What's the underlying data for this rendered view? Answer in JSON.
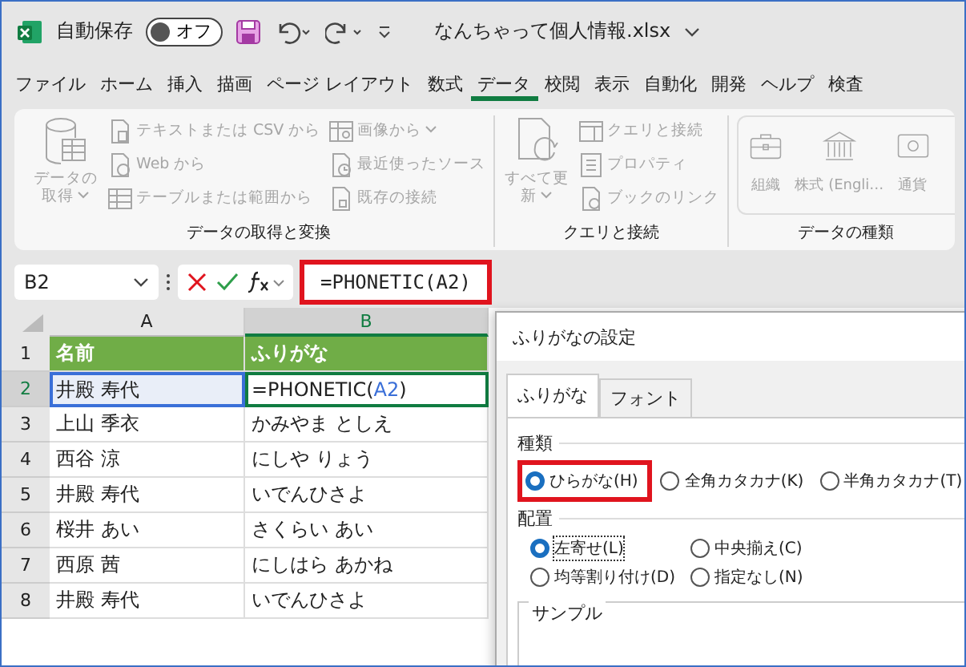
{
  "title_bar": {
    "autosave_label": "自動保存",
    "autosave_toggle": {
      "label": "オフ",
      "on": false
    },
    "file_name": "なんちゃって個人情報.xlsx"
  },
  "menu_tabs": [
    {
      "label": "ファイル",
      "selected": false
    },
    {
      "label": "ホーム",
      "selected": false
    },
    {
      "label": "挿入",
      "selected": false
    },
    {
      "label": "描画",
      "selected": false
    },
    {
      "label": "ページ レイアウト",
      "selected": false
    },
    {
      "label": "数式",
      "selected": false
    },
    {
      "label": "データ",
      "selected": true
    },
    {
      "label": "校閲",
      "selected": false
    },
    {
      "label": "表示",
      "selected": false
    },
    {
      "label": "自動化",
      "selected": false
    },
    {
      "label": "開発",
      "selected": false
    },
    {
      "label": "ヘルプ",
      "selected": false
    },
    {
      "label": "検査",
      "selected": false
    }
  ],
  "ribbon_groups": [
    {
      "label": "データの取得と変換",
      "columns": [
        [
          {
            "label": "データの取得",
            "kind": "large",
            "dropdown": true,
            "disabled": true
          }
        ],
        [
          {
            "label": "テキストまたは CSV から",
            "kind": "small",
            "dropdown": false,
            "disabled": true
          },
          {
            "label": "Web から",
            "kind": "small",
            "dropdown": false,
            "disabled": true
          },
          {
            "label": "テーブルまたは範囲から",
            "kind": "small",
            "dropdown": false,
            "disabled": true
          }
        ],
        [
          {
            "label": "画像から",
            "kind": "small",
            "dropdown": true,
            "disabled": true
          },
          {
            "label": "最近使ったソース",
            "kind": "small",
            "dropdown": false,
            "disabled": true
          },
          {
            "label": "既存の接続",
            "kind": "small",
            "dropdown": false,
            "disabled": true
          }
        ]
      ]
    },
    {
      "label": "クエリと接続",
      "columns": [
        [
          {
            "label": "すべて更新",
            "kind": "large",
            "dropdown": true,
            "disabled": true
          }
        ],
        [
          {
            "label": "クエリと接続",
            "kind": "small",
            "dropdown": false,
            "disabled": true
          },
          {
            "label": "プロパティ",
            "kind": "small",
            "dropdown": false,
            "disabled": true
          },
          {
            "label": "ブックのリンク",
            "kind": "small",
            "dropdown": false,
            "disabled": true
          }
        ]
      ]
    },
    {
      "label": "データの種類",
      "columns": [
        [
          {
            "label": "組織",
            "kind": "type",
            "dropdown": false,
            "disabled": true
          }
        ],
        [
          {
            "label": "株式 (Engli…",
            "kind": "type",
            "dropdown": false,
            "disabled": true
          }
        ],
        [
          {
            "label": "通貨",
            "kind": "type",
            "dropdown": false,
            "disabled": true
          }
        ]
      ]
    }
  ],
  "formula_bar": {
    "name_box": "B2",
    "formula": "=PHONETIC(A2)",
    "highlighted": true
  },
  "sheet": {
    "columns": [
      {
        "label": "A",
        "selected": false
      },
      {
        "label": "B",
        "selected": true
      }
    ],
    "rows": [
      {
        "number": "1",
        "selected": false,
        "kind": "header",
        "cells": [
          {
            "text": "名前"
          },
          {
            "text": "ふりがな"
          }
        ]
      },
      {
        "number": "2",
        "selected": true,
        "kind": "data",
        "cells": [
          {
            "text": "井殿 寿代",
            "referenced": true
          },
          {
            "parts": [
              {
                "text": "=PHONETIC(",
                "kind": "plain"
              },
              {
                "text": "A2",
                "kind": "ref"
              },
              {
                "text": ")",
                "kind": "plain"
              }
            ],
            "active": true
          }
        ]
      },
      {
        "number": "3",
        "selected": false,
        "kind": "data",
        "cells": [
          {
            "text": "上山 季衣"
          },
          {
            "text": "かみやま としえ"
          }
        ]
      },
      {
        "number": "4",
        "selected": false,
        "kind": "data",
        "cells": [
          {
            "text": "西谷 涼"
          },
          {
            "text": "にしや りょう"
          }
        ]
      },
      {
        "number": "5",
        "selected": false,
        "kind": "data",
        "cells": [
          {
            "text": "井殿 寿代"
          },
          {
            "text": "いでんひさよ"
          }
        ]
      },
      {
        "number": "6",
        "selected": false,
        "kind": "data",
        "cells": [
          {
            "text": "桜井 あい"
          },
          {
            "text": "さくらい あい"
          }
        ]
      },
      {
        "number": "7",
        "selected": false,
        "kind": "data",
        "cells": [
          {
            "text": "西原 茜"
          },
          {
            "text": "にしはら あかね"
          }
        ]
      },
      {
        "number": "8",
        "selected": false,
        "kind": "data",
        "cells": [
          {
            "text": "井殿 寿代"
          },
          {
            "text": "いでんひさよ"
          }
        ]
      }
    ]
  },
  "dialog": {
    "title": "ふりがなの設定",
    "tabs": [
      {
        "label": "ふりがな",
        "selected": true
      },
      {
        "label": "フォント",
        "selected": false
      }
    ],
    "type_group": {
      "label": "種類",
      "options": [
        {
          "label": "ひらがな(H)",
          "selected": true,
          "highlighted": true
        },
        {
          "label": "全角カタカナ(K)",
          "selected": false,
          "highlighted": false
        },
        {
          "label": "半角カタカナ(T)",
          "selected": false,
          "highlighted": false
        }
      ]
    },
    "align_group": {
      "label": "配置",
      "options": [
        {
          "label": "左寄せ(L)",
          "selected": true,
          "focused": true
        },
        {
          "label": "中央揃え(C)",
          "selected": false,
          "focused": false
        },
        {
          "label": "均等割り付け(D)",
          "selected": false,
          "focused": false
        },
        {
          "label": "指定なし(N)",
          "selected": false,
          "focused": false
        }
      ]
    },
    "sample_label": "サンプル"
  }
}
